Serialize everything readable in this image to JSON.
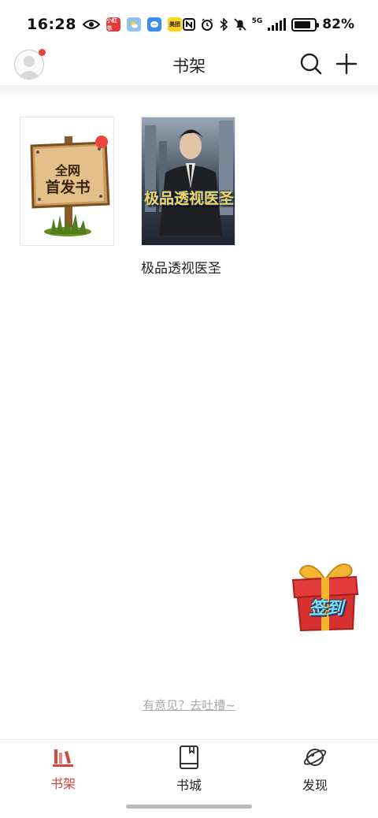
{
  "status_bar": {
    "time": "16:28",
    "battery_percent": "82%",
    "battery_level": 0.82,
    "network": "5G",
    "app_icons": [
      {
        "name": "xiaohongshu-icon",
        "label": "小红书",
        "color": "#e4393c"
      },
      {
        "name": "weather-icon",
        "label": "",
        "color": "#8ec3ee"
      },
      {
        "name": "messages-icon",
        "label": "",
        "color": "#3d8df0"
      },
      {
        "name": "meituan-icon",
        "label": "美团",
        "color": "#ffd21f"
      }
    ],
    "status_icons": [
      "eye-icon",
      "nfc-icon",
      "alarm-icon",
      "bluetooth-icon",
      "mute-icon",
      "signal-icon",
      "battery-icon"
    ]
  },
  "header": {
    "title": "书架",
    "avatar_icon": "user-avatar-icon",
    "search_icon": "search-icon",
    "add_icon": "plus-icon",
    "notification_color": "#e8453c"
  },
  "shelf": {
    "books": [
      {
        "title": "",
        "cover_text_line1": "全网",
        "cover_text_line2": "首发书",
        "cover_icon": "wooden-signpost-icon",
        "has_new_badge": true
      },
      {
        "title": "极品透视医圣",
        "cover_title": "极品透视医圣",
        "cover_icon": "book-cover-man-in-suit"
      }
    ]
  },
  "sign_in": {
    "label": "签到",
    "icon": "gift-box-icon"
  },
  "feedback": {
    "label": "有意见？去吐槽~"
  },
  "bottom_nav": {
    "active_color": "#d7453e",
    "items": [
      {
        "label": "书架",
        "icon": "bookshelf-icon",
        "active": true
      },
      {
        "label": "书城",
        "icon": "book-store-icon",
        "active": false
      },
      {
        "label": "发现",
        "icon": "planet-icon",
        "active": false
      }
    ]
  }
}
